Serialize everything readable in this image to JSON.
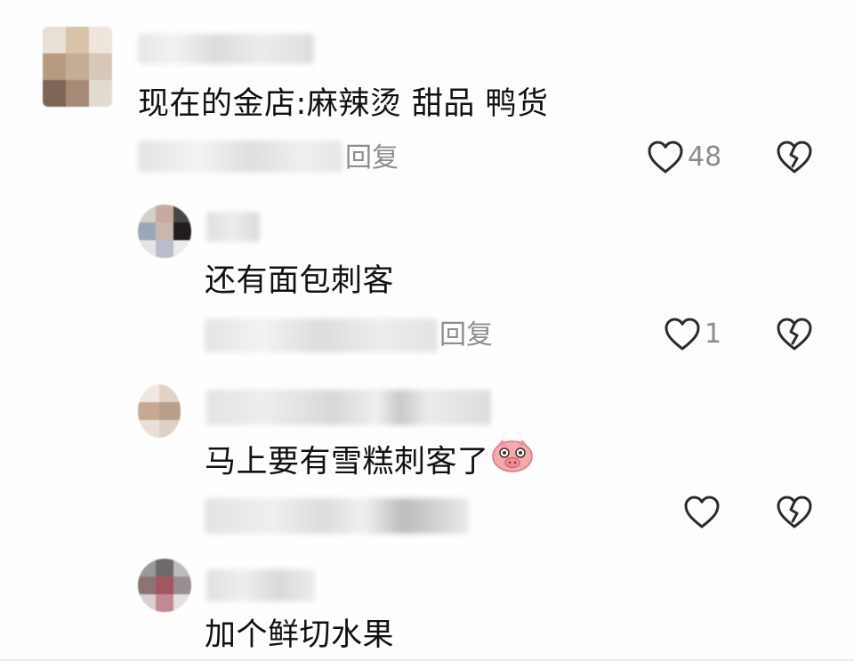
{
  "comments": [
    {
      "text": "现在的金店:麻辣烫 甜品 鸭货",
      "reply_label": "回复",
      "like_count": "48"
    },
    {
      "text": "还有面包刺客",
      "reply_label": "回复",
      "like_count": "1"
    },
    {
      "text": "马上要有雪糕刺客了",
      "emoji": "pig-face-emoji",
      "reply_label": "",
      "like_count": ""
    },
    {
      "text": "加个鲜切水果"
    }
  ],
  "icons": {
    "like": "heart-outline-icon",
    "dislike": "broken-heart-outline-icon"
  },
  "colors": {
    "text": "#111111",
    "meta": "#8e8e8e",
    "icon": "#2b2b2b",
    "pig": "#f7a9ad"
  }
}
